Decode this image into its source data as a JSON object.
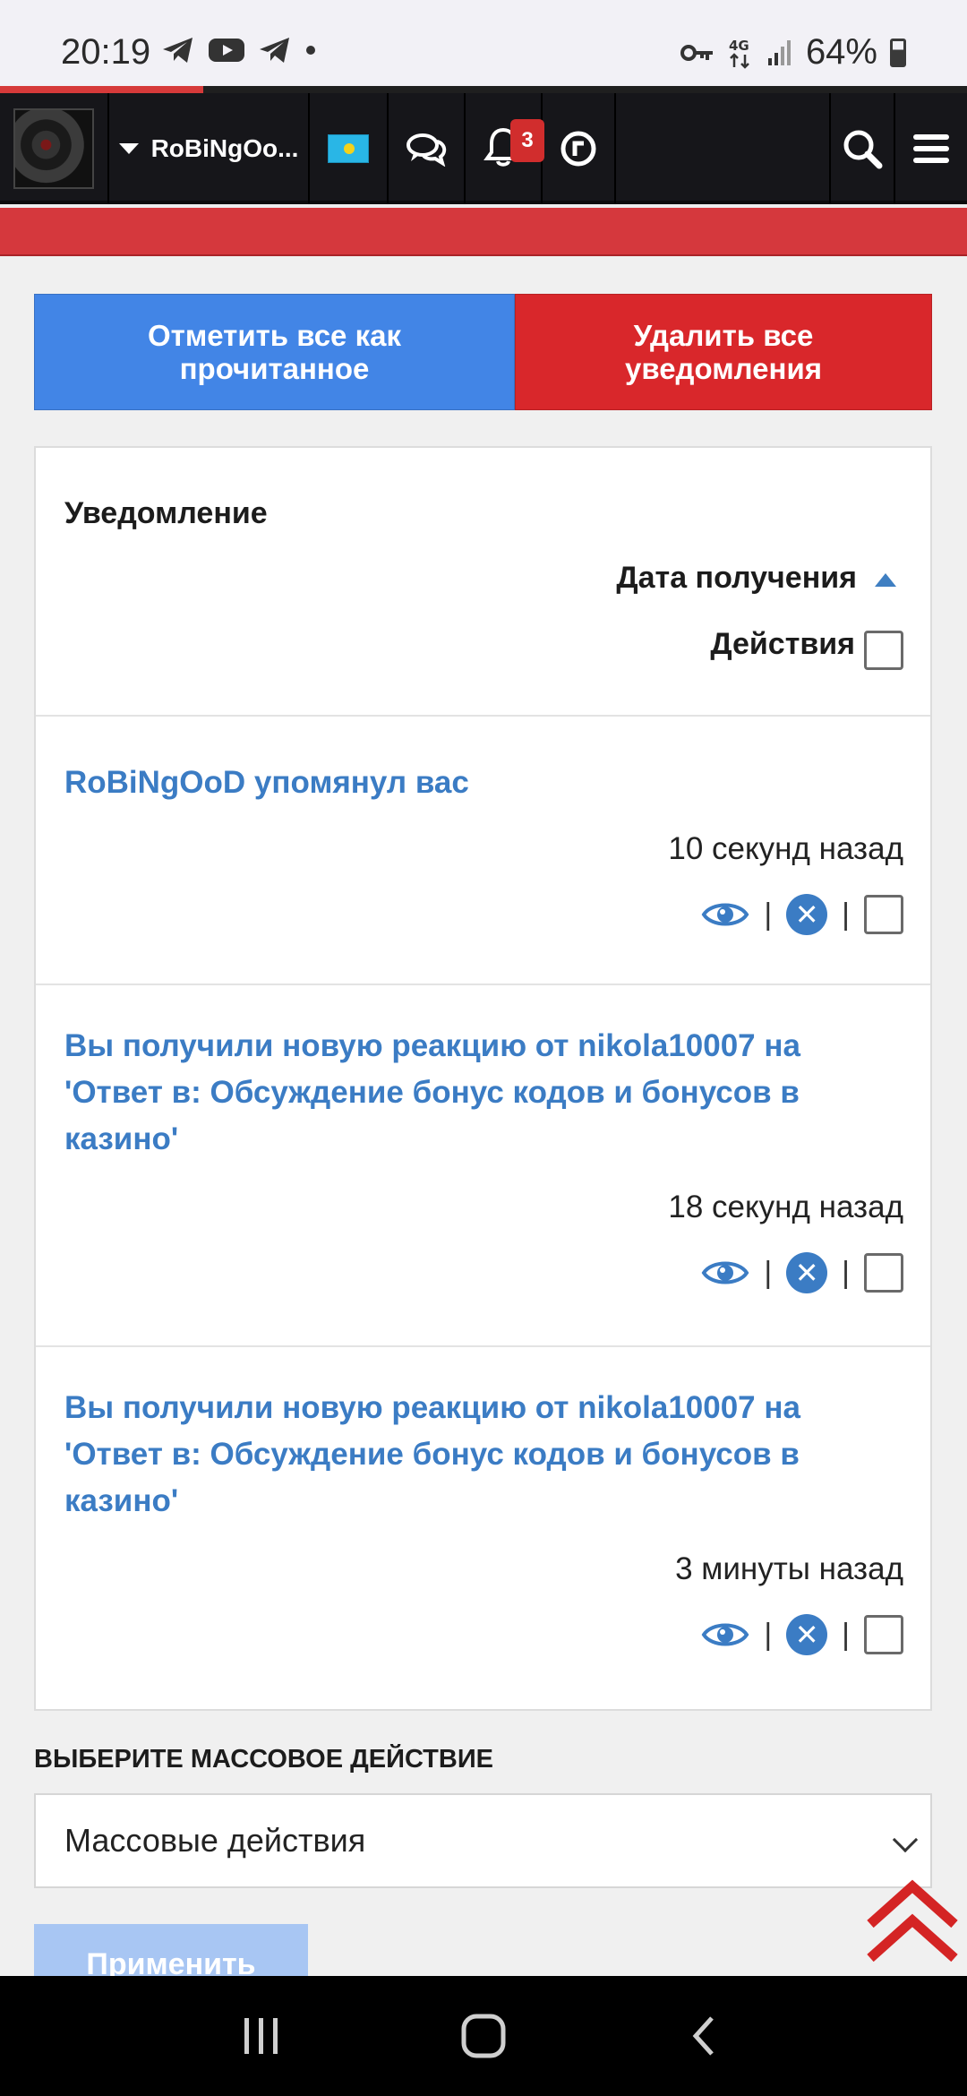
{
  "status_bar": {
    "time": "20:19",
    "battery": "64%",
    "battery_level": 0.64,
    "network": "4G",
    "icons": [
      "telegram-icon",
      "youtube-icon",
      "telegram-icon",
      "dot-icon",
      "key-icon",
      "network-4g-icon",
      "signal-icon",
      "battery-icon"
    ]
  },
  "page_load_progress": 0.21,
  "nav": {
    "username": "RoBiNgOo...",
    "notification_count": "3",
    "icons": [
      "avatar",
      "caret-down-icon",
      "flag-kz-icon",
      "chat-icon",
      "bell-icon",
      "history-icon",
      "search-icon",
      "menu-icon"
    ]
  },
  "buttons": {
    "mark_all_read": "Отметить все как прочитанное",
    "delete_all": "Удалить все уведомления"
  },
  "table": {
    "header_notification": "Уведомление",
    "header_date": "Дата получения",
    "header_actions": "Действия",
    "rows": [
      {
        "title": "RoBiNgOoD упомянул вас",
        "time": "10 секунд назад"
      },
      {
        "title": "Вы получили новую реакцию от nikola10007 на 'Ответ в: Обсуждение бонус кодов и бонусов в казино'",
        "time": "18 секунд назад"
      },
      {
        "title": "Вы получили новую реакцию от nikola10007 на 'Ответ в: Обсуждение бонус кодов и бонусов в казино'",
        "time": "3 минуты назад"
      }
    ],
    "separator": "|"
  },
  "mass_action": {
    "label": "ВЫБЕРИТЕ МАССОВОЕ ДЕЙСТВИЕ",
    "selected": "Массовые действия",
    "apply": "Применить"
  },
  "colors": {
    "accent_blue": "#4285e6",
    "accent_red": "#d9272b",
    "link_blue": "#3b7cc4",
    "nav_bg": "#16161a"
  }
}
